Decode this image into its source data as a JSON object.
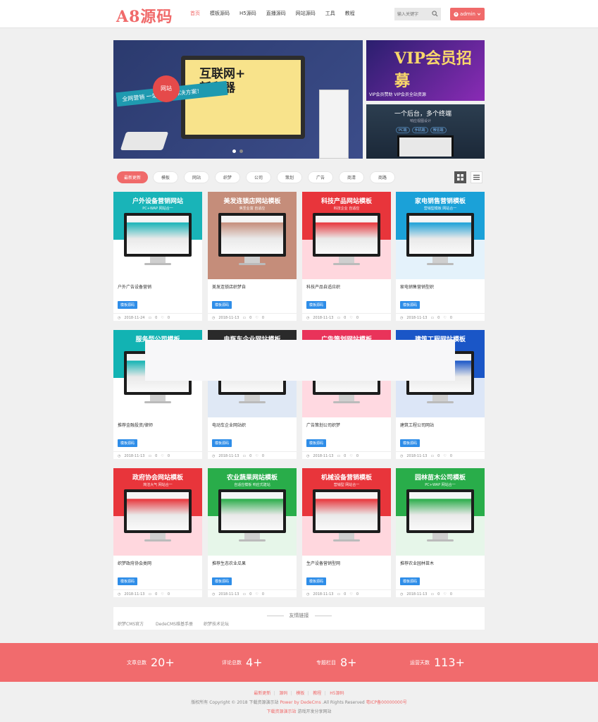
{
  "header": {
    "logo": "A8源码",
    "nav": [
      "首页",
      "模板源码",
      "H5源码",
      "直播源码",
      "网站源码",
      "工具",
      "教程"
    ],
    "search_placeholder": "输入关键字",
    "user_label": "admin"
  },
  "banner": {
    "main_title_1": "互联网+",
    "main_title_2": "新利器",
    "badge": "网站",
    "ribbon": "全网营销  一站式网站解决方案！",
    "side1_title": "VIP会员招募",
    "side1_caption": "VIP会员赞助 VIP会员全站资源",
    "side2_title": "一个后台，多个终端",
    "side2_sub": "响应视图设计",
    "side2_chips": [
      "PC端",
      "手机端",
      "微信端"
    ]
  },
  "filters": [
    "最新更新",
    "模板",
    "网站",
    "织梦",
    "公司",
    "策划",
    "广告",
    "商清",
    "商路"
  ],
  "cards": [
    {
      "title": "户外设备营销网站",
      "sub": "PC+WAP 网站合一",
      "name": "户外广告设备营销",
      "date": "2018-11-24",
      "bg": "#19b4b8",
      "foot": "#ffffff"
    },
    {
      "title": "美发连锁店网站模板",
      "sub": "焦圣业富 自适应",
      "name": "美发连锁店织梦自",
      "date": "2018-11-13",
      "bg": "#c58d7a",
      "foot": "#c58d7a"
    },
    {
      "title": "科技产品网站模板",
      "sub": "科技企业 自适应",
      "name": "科技产品自适应织",
      "date": "2018-11-13",
      "bg": "#e8353b",
      "foot": "#ffd7de"
    },
    {
      "title": "家电销售营销模板",
      "sub": "营销型模板 网站合一",
      "name": "家电销售营销型织",
      "date": "2018-11-13",
      "bg": "#1ba1d8",
      "foot": "#e4f2fb"
    },
    {
      "title": "服务型公司模板",
      "sub": "",
      "name": "推荐金融投资/律师",
      "date": "2018-11-13",
      "bg": "#12b3b3",
      "foot": "#ffffff"
    },
    {
      "title": "电瓶车企业网站模板",
      "sub": "",
      "name": "电动车企业网站织",
      "date": "2018-11-13",
      "bg": "#2a2a2a",
      "foot": "#dfe8f5"
    },
    {
      "title": "广告策划网站模板",
      "sub": "",
      "name": "广告策划公司织梦",
      "date": "2018-11-13",
      "bg": "#e9335a",
      "foot": "#ffd9e1"
    },
    {
      "title": "建筑工程网站模板",
      "sub": "",
      "name": "建筑工程公司网站",
      "date": "2018-11-13",
      "bg": "#1a56c7",
      "foot": "#dce6f7"
    },
    {
      "title": "政府协会网站模板",
      "sub": "简洁大气 网站合一",
      "name": "织梦政府协会类网",
      "date": "2018-11-13",
      "bg": "#e8353b",
      "foot": "#ffd7de"
    },
    {
      "title": "农业蔬果网站模板",
      "sub": "自适应模板 响应式建站",
      "name": "推荐生态农业瓜果",
      "date": "2018-11-13",
      "bg": "#29ad4a",
      "foot": "#e6f6e9"
    },
    {
      "title": "机械设备营销模板",
      "sub": "营销型 网站合一",
      "name": "生产设备营销型网",
      "date": "2018-11-13",
      "bg": "#e8353b",
      "foot": "#ffd7de"
    },
    {
      "title": "园林苗木公司模板",
      "sub": "PC+WAP 网站合一",
      "name": "推荐农业园林苗木",
      "date": "2018-11-13",
      "bg": "#29ad4a",
      "foot": "#e6f6e9"
    }
  ],
  "card_tag": "模板源码",
  "card_comments": "0",
  "card_likes": "0",
  "links": {
    "title": "友情链接",
    "items": [
      "织梦CMS官方",
      "DedeCMS维基手册",
      "织梦技术论坛"
    ]
  },
  "stats": [
    {
      "label": "文章总数",
      "value": "20+"
    },
    {
      "label": "评论总数",
      "value": "4+"
    },
    {
      "label": "专题栏目",
      "value": "8+"
    },
    {
      "label": "运营天数",
      "value": "113+"
    }
  ],
  "footer": {
    "links": [
      "最新更新",
      "源码",
      "模板",
      "教程",
      "H5源码"
    ],
    "copyright": "版权所有 Copyright © 2018 下载资源演示站",
    "powered": "Power by DedeCms",
    "rights": " .All Rights Reserved",
    "icp": "粤ICP备00000000号",
    "site": "下载资源演示站",
    "tagline": " 游戏开发分享网站"
  },
  "colors": {
    "accent": "#f06a6a",
    "tag": "#2e8de8",
    "stats_bg": "#f16b6d"
  }
}
